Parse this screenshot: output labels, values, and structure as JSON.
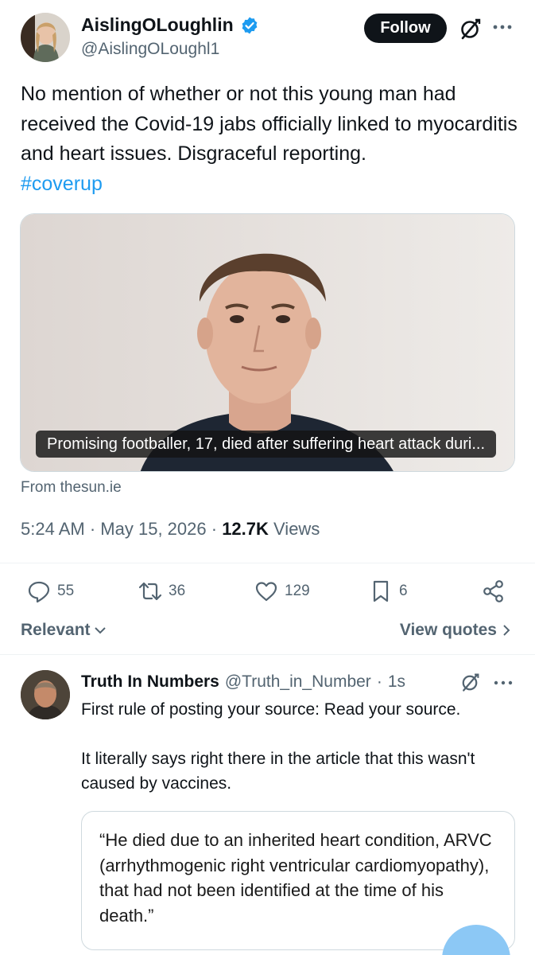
{
  "tweet": {
    "author_name": "AislingOLoughlin",
    "author_handle": "@AislingOLoughl1",
    "follow_label": "Follow",
    "text": "No mention of whether or not this young man had received the Covid-19 jabs officially linked to myocarditis and heart issues. Disgraceful reporting.",
    "hashtag": "#coverup",
    "media_caption": "Promising footballer, 17, died after suffering heart attack duri...",
    "source": "From thesun.ie",
    "time": "5:24 AM",
    "date": "May 15, 2026",
    "separator": "·",
    "views_count": "12.7K",
    "views_label": "Views"
  },
  "actions": {
    "replies": "55",
    "retweets": "36",
    "likes": "129",
    "bookmarks": "6"
  },
  "filters": {
    "sort_label": "Relevant",
    "view_quotes_label": "View quotes"
  },
  "reply": {
    "author_name": "Truth In Numbers",
    "author_handle": "@Truth_in_Number",
    "separator": "·",
    "time": "1s",
    "paragraph1": "First rule of posting your source: Read your source.",
    "paragraph2": "It literally says right there in the article that this wasn't caused by vaccines.",
    "quote": "“He died due to an inherited heart condition, ARVC (arrhythmogenic right ventricular cardiomyopathy), that had not been identified at the time of his death.”"
  },
  "icons": {
    "verified": "verified-badge-icon",
    "grok": "grok-icon",
    "more": "more-icon",
    "reply": "reply-icon",
    "retweet": "retweet-icon",
    "like": "heart-icon",
    "bookmark": "bookmark-icon",
    "share": "share-icon"
  },
  "colors": {
    "accent": "#1d9bf0",
    "text": "#0f1419",
    "secondary": "#536471"
  }
}
